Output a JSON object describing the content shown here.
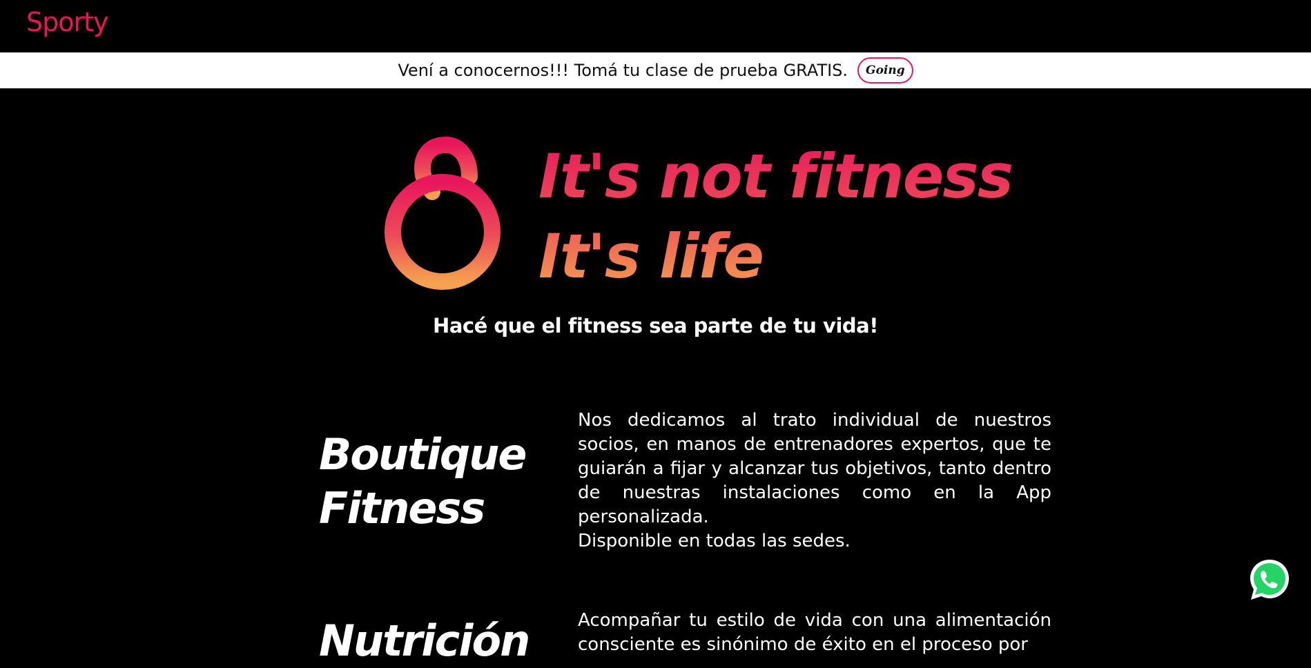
{
  "header": {
    "brand": "Sporty"
  },
  "promo": {
    "text": "Vení a conocernos!!! Tomá tu clase de prueba GRATIS.",
    "button_label": "Going"
  },
  "hero": {
    "slogan_line1": "It's not fitness",
    "slogan_line2": "It's life",
    "tagline": "Hacé que el fitness sea parte de tu vida!"
  },
  "sections": [
    {
      "title_line1": "Boutique",
      "title_line2": "Fitness",
      "text": "Nos dedicamos al trato individual de nuestros socios, en manos de entrenadores expertos, que te guiarán a fijar y alcanzar tus objetivos, tanto dentro de nuestras instalaciones como en la App personalizada.",
      "text2": "Disponible en todas las sedes."
    },
    {
      "title_line1": "Nutrición",
      "text": "Acompañar tu estilo de vida con una alimentación consciente es sinónimo de éxito en el proceso por"
    }
  ],
  "colors": {
    "brand": "#e8175d",
    "gradient_end": "#f4a150",
    "whatsapp": "#25d366"
  },
  "icons": {
    "floating": "whatsapp-icon",
    "hero_logo": "sporty-s-logo"
  }
}
